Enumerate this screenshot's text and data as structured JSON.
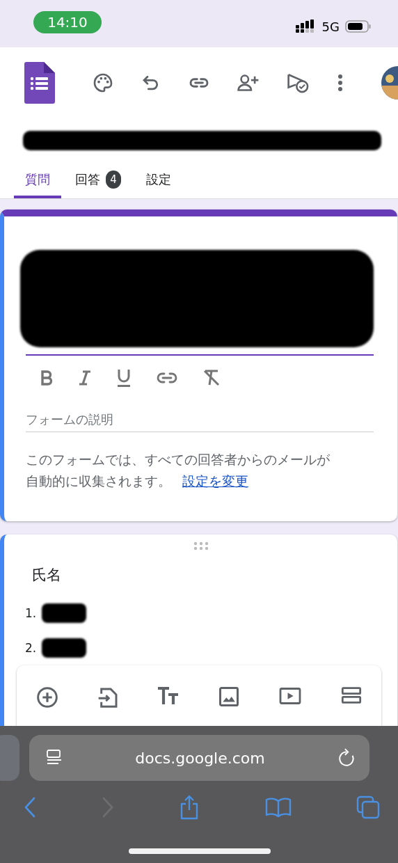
{
  "status_bar": {
    "time": "14:10",
    "network": "5G"
  },
  "tabs": [
    {
      "label": "質問",
      "selected": true
    },
    {
      "label": "回答",
      "selected": false,
      "badge": "4"
    },
    {
      "label": "設定",
      "selected": false
    }
  ],
  "form_card": {
    "description": {
      "placeholder": "フォームの説明"
    },
    "notice": "このフォームでは、すべての回答者からのメールが自動的に収集されます。",
    "notice_link": "設定を変更"
  },
  "question": {
    "title": "氏名",
    "items": [
      "1.",
      "2."
    ]
  },
  "browser": {
    "url": "docs.google.com",
    "nav": [
      {
        "kind": "back",
        "disabled": false
      },
      {
        "kind": "forward",
        "disabled": true
      },
      {
        "kind": "share",
        "disabled": false
      },
      {
        "kind": "bookmarks",
        "disabled": false
      },
      {
        "kind": "tabs",
        "disabled": false
      }
    ]
  }
}
